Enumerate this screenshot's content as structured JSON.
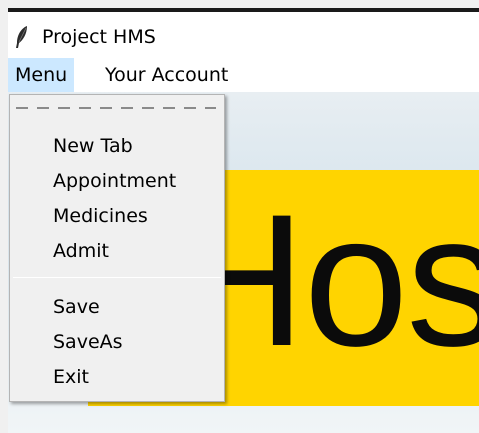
{
  "window": {
    "title": "Project HMS",
    "icon": "feather-icon"
  },
  "menubar": {
    "items": [
      {
        "label": "Menu",
        "active": true
      },
      {
        "label": "Your Account",
        "active": false
      }
    ]
  },
  "dropdown": {
    "tearoff": true,
    "group1": [
      "New Tab",
      "Appointment",
      "Medicines",
      "Admit"
    ],
    "group2": [
      "Save",
      "SaveAs",
      "Exit"
    ]
  },
  "content": {
    "banner_text": "Hos",
    "banner_color": "#ffd400"
  }
}
